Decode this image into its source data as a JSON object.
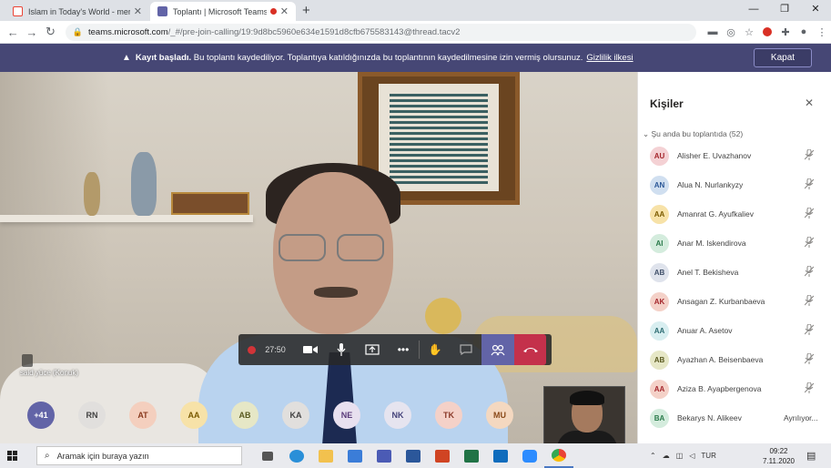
{
  "browser": {
    "tabs": [
      {
        "title": "Islam in Today's World - merazh",
        "favicon_color": "#ea4335"
      },
      {
        "title": "Toplantı | Microsoft Teams",
        "favicon_color": "#6264a7"
      }
    ],
    "url_host": "teams.microsoft.com",
    "url_path": "/_#/pre-join-calling/19:9d8bc5960e634e1591d8cfb675583143@thread.tacv2"
  },
  "banner": {
    "bold": "Kayıt başladı.",
    "message": "Bu toplantı kaydediliyor. Toplantıya katıldığınızda bu toplantının kaydedilmesine izin vermiş olursunuz.",
    "link": "Gizlilik ilkesi",
    "close_label": "Kapat",
    "bg_color": "#464775"
  },
  "video": {
    "speaker_caption": "said yüce (Konuk)",
    "timer": "27:50"
  },
  "controls": {
    "icons": [
      "camera-icon",
      "microphone-icon",
      "share-screen-icon",
      "more-options-icon",
      "raise-hand-icon",
      "chat-icon",
      "people-icon",
      "hang-up-icon"
    ]
  },
  "avatar_row": [
    {
      "initials": "+41",
      "bg": "#6264a7",
      "fg": "#ffffff"
    },
    {
      "initials": "RN",
      "bg": "#e1dfdd",
      "fg": "#424242"
    },
    {
      "initials": "AT",
      "bg": "#f4cfbe",
      "fg": "#8a3a1e"
    },
    {
      "initials": "AA",
      "bg": "#f7e2a8",
      "fg": "#7a5a00"
    },
    {
      "initials": "AB",
      "bg": "#e6e7c6",
      "fg": "#5a5a20"
    },
    {
      "initials": "KA",
      "bg": "#e1dfdd",
      "fg": "#424242"
    },
    {
      "initials": "NE",
      "bg": "#e8e0ef",
      "fg": "#5a3a7a"
    },
    {
      "initials": "NK",
      "bg": "#e6e4ef",
      "fg": "#44427a"
    },
    {
      "initials": "TK",
      "bg": "#f4d1c8",
      "fg": "#8a3a2a"
    },
    {
      "initials": "MU",
      "bg": "#f4d8c0",
      "fg": "#8a4a1a"
    }
  ],
  "people_panel": {
    "title": "Kişiler",
    "section": "Şu anda bu toplantıda (52)",
    "participants": [
      {
        "initials": "AU",
        "name": "Alisher E. Uvazhanov",
        "bg": "#f4d1d4",
        "fg": "#a4262c",
        "status": ""
      },
      {
        "initials": "AN",
        "name": "Alua N. Nurlankyzy",
        "bg": "#d0dff0",
        "fg": "#2b5797",
        "status": ""
      },
      {
        "initials": "AA",
        "name": "Amanrat G. Ayufkaliev",
        "bg": "#f7e2a8",
        "fg": "#7a5a00",
        "status": ""
      },
      {
        "initials": "AI",
        "name": "Anar M. Iskendirova",
        "bg": "#d4ecdd",
        "fg": "#2a7a4a",
        "status": ""
      },
      {
        "initials": "AB",
        "name": "Anel T. Bekisheva",
        "bg": "#dfe3ec",
        "fg": "#40506a",
        "status": ""
      },
      {
        "initials": "AK",
        "name": "Ansagan Z. Kurbanbaeva",
        "bg": "#f4d1c8",
        "fg": "#a4262c",
        "status": ""
      },
      {
        "initials": "AA",
        "name": "Anuar A. Asetov",
        "bg": "#d8eef0",
        "fg": "#2a6a70",
        "status": ""
      },
      {
        "initials": "AB",
        "name": "Ayazhan A. Beisenbaeva",
        "bg": "#e6e7c6",
        "fg": "#5a5a20",
        "status": ""
      },
      {
        "initials": "AA",
        "name": "Aziza B. Ayapbergenova",
        "bg": "#f4d1c8",
        "fg": "#a4262c",
        "status": ""
      },
      {
        "initials": "BA",
        "name": "Bekarys N. Alikeev",
        "bg": "#d4ecdd",
        "fg": "#2a7a4a",
        "status": "Ayrılıyor..."
      }
    ]
  },
  "taskbar": {
    "search_placeholder": "Aramak için buraya yazın",
    "lang": "TUR",
    "time": "09:22",
    "date": "7.11.2020"
  }
}
